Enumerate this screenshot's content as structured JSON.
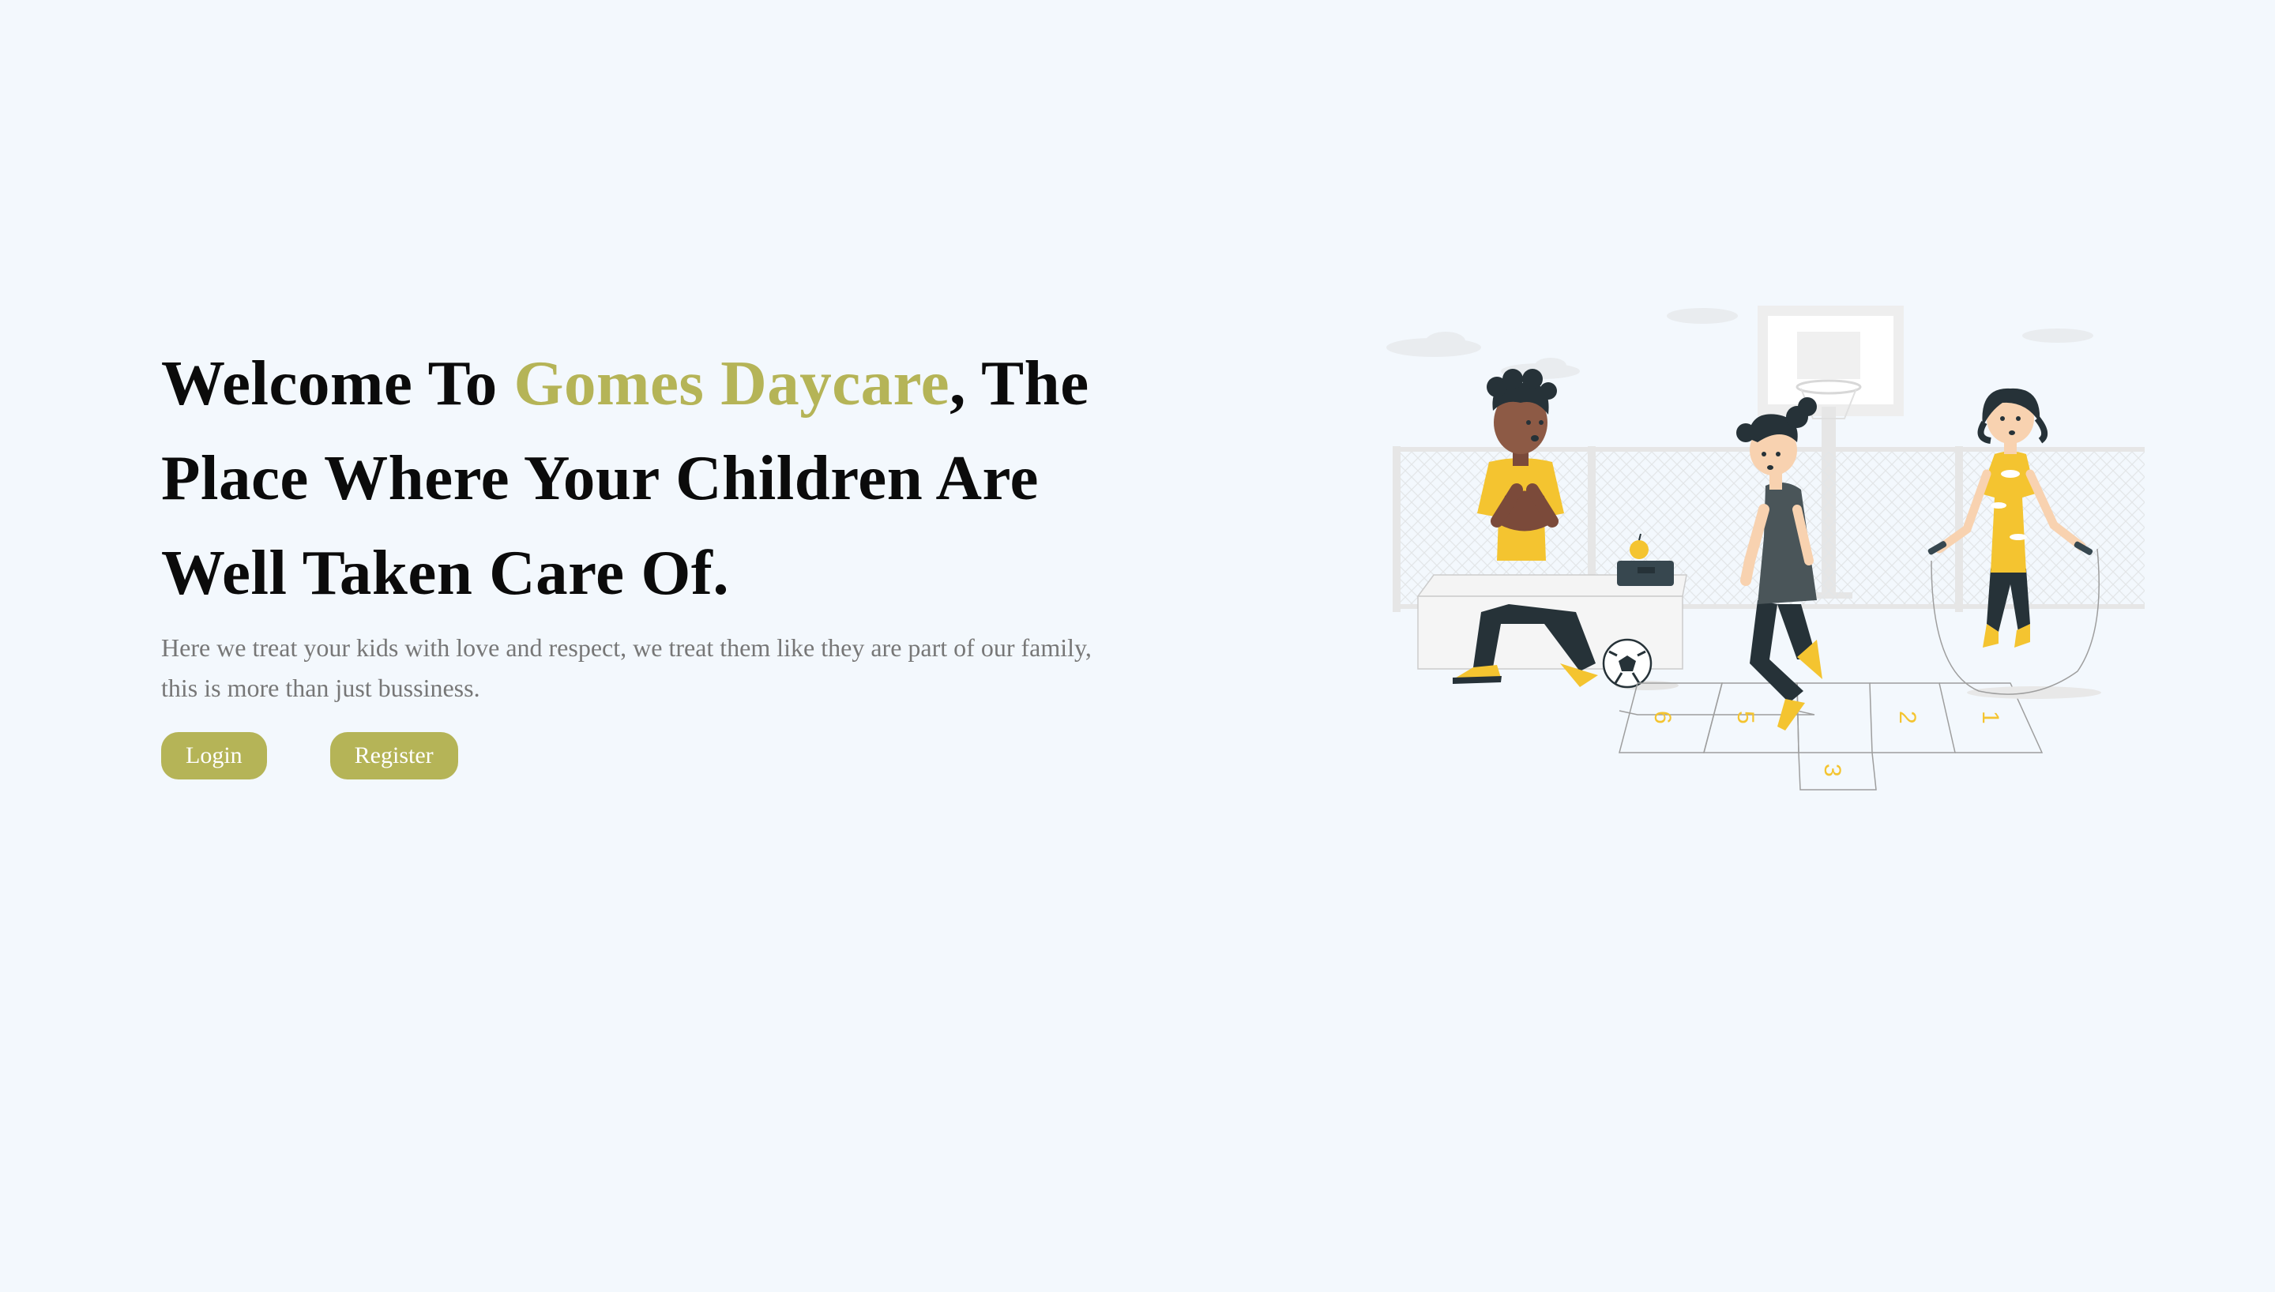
{
  "hero": {
    "headline_before": "Welcome To ",
    "headline_brand": "Gomes Daycare",
    "headline_after": ", The Place Where Your Children Are Well Taken Care Of.",
    "tagline": "Here we treat your kids with love and respect, we treat them like they are part of our family, this is more than just bussiness."
  },
  "buttons": {
    "login_label": "Login",
    "register_label": "Register"
  },
  "illustration": {
    "hopscotch_numbers": [
      "6",
      "5",
      "3",
      "2",
      "1"
    ]
  },
  "colors": {
    "background": "#f3f8fd",
    "brand": "#b5b457",
    "headline": "#0b0b0b",
    "tagline": "#777777",
    "accent_yellow": "#f4c430",
    "dark_clothing": "#263238"
  }
}
